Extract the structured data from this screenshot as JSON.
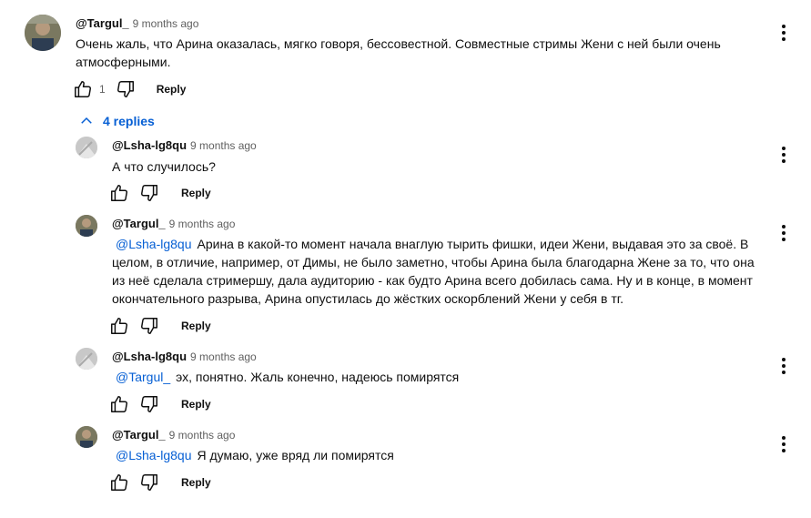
{
  "comments": [
    {
      "author": "@Targul_",
      "time": "9 months ago",
      "text": "Очень жаль, что Арина оказалась, мягко говоря, бессовестной. Совместные стримы Жени с ней были очень атмосферными.",
      "likes": "1",
      "reply_label": "Reply"
    }
  ],
  "replies_toggle": {
    "label": "4 replies"
  },
  "replies": [
    {
      "author": "@Lsha-lg8qu",
      "time": "9 months ago",
      "mention": "",
      "text": "А что случилось?",
      "reply_label": "Reply"
    },
    {
      "author": "@Targul_",
      "time": "9 months ago",
      "mention": "@Lsha-lg8qu",
      "text": "Арина в какой-то момент начала внаглую тырить фишки, идеи Жени, выдавая это за своё. В целом, в отличие, например, от Димы, не было заметно, чтобы Арина была благодарна Жене за то, что она из неё сделала стримершу, дала аудиторию - как будто Арина всего добилась сама. Ну и в конце, в момент окончательного разрыва, Арина опустилась до жёстких оскорблений Жени у себя в тг.",
      "reply_label": "Reply"
    },
    {
      "author": "@Lsha-lg8qu",
      "time": "9 months ago",
      "mention": "@Targul_",
      "text": "эх, понятно. Жаль конечно, надеюсь помирятся",
      "reply_label": "Reply"
    },
    {
      "author": "@Targul_",
      "time": "9 months ago",
      "mention": "@Lsha-lg8qu",
      "text": "Я думаю, уже вряд ли помирятся",
      "reply_label": "Reply"
    }
  ],
  "colors": {
    "link": "#065fd4",
    "text": "#0f0f0f",
    "muted": "#606060"
  },
  "icons": [
    "thumb-up-icon",
    "thumb-down-icon",
    "more-vert-icon",
    "chevron-up-icon"
  ]
}
